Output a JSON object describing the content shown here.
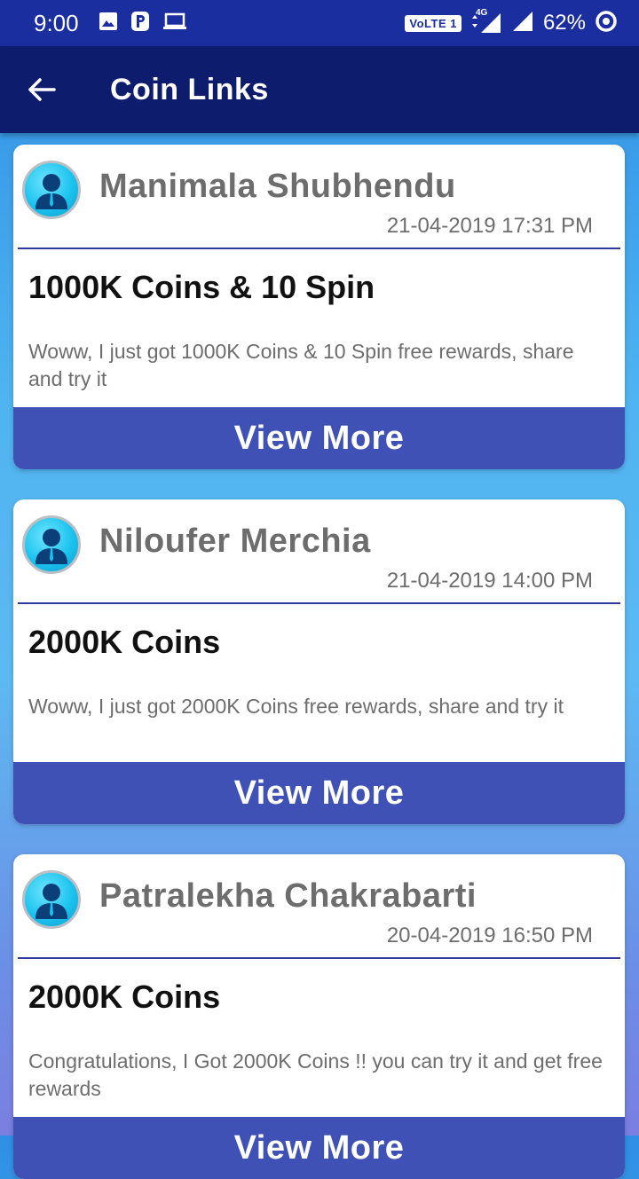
{
  "status_bar": {
    "time": "9:00",
    "icons": [
      "image-icon",
      "parking-icon",
      "laptop-icon"
    ],
    "network": "VoLTE 1",
    "data_type": "4G",
    "battery": "62%"
  },
  "app_bar": {
    "title": "Coin Links"
  },
  "cards": [
    {
      "name": "Manimala Shubhendu",
      "timestamp": "21-04-2019 17:31 PM",
      "title": "1000K Coins & 10 Spin",
      "description": "Woww, I just got 1000K Coins & 10 Spin  free rewards, share and try it",
      "button": "View More"
    },
    {
      "name": "Niloufer Merchia",
      "timestamp": "21-04-2019 14:00 PM",
      "title": "2000K Coins",
      "description": "Woww, I just got 2000K Coins  free rewards, share and try it",
      "button": "View More"
    },
    {
      "name": "Patralekha Chakrabarti",
      "timestamp": "20-04-2019 16:50 PM",
      "title": "2000K Coins",
      "description": "Congratulations, I Got 2000K Coins  !! you can try it and get free rewards",
      "button": "View More"
    }
  ],
  "colors": {
    "status_bar": "#1a2ea0",
    "app_bar": "#0e1c6e",
    "button": "#3f51b5",
    "divider": "#2b3a9a"
  }
}
